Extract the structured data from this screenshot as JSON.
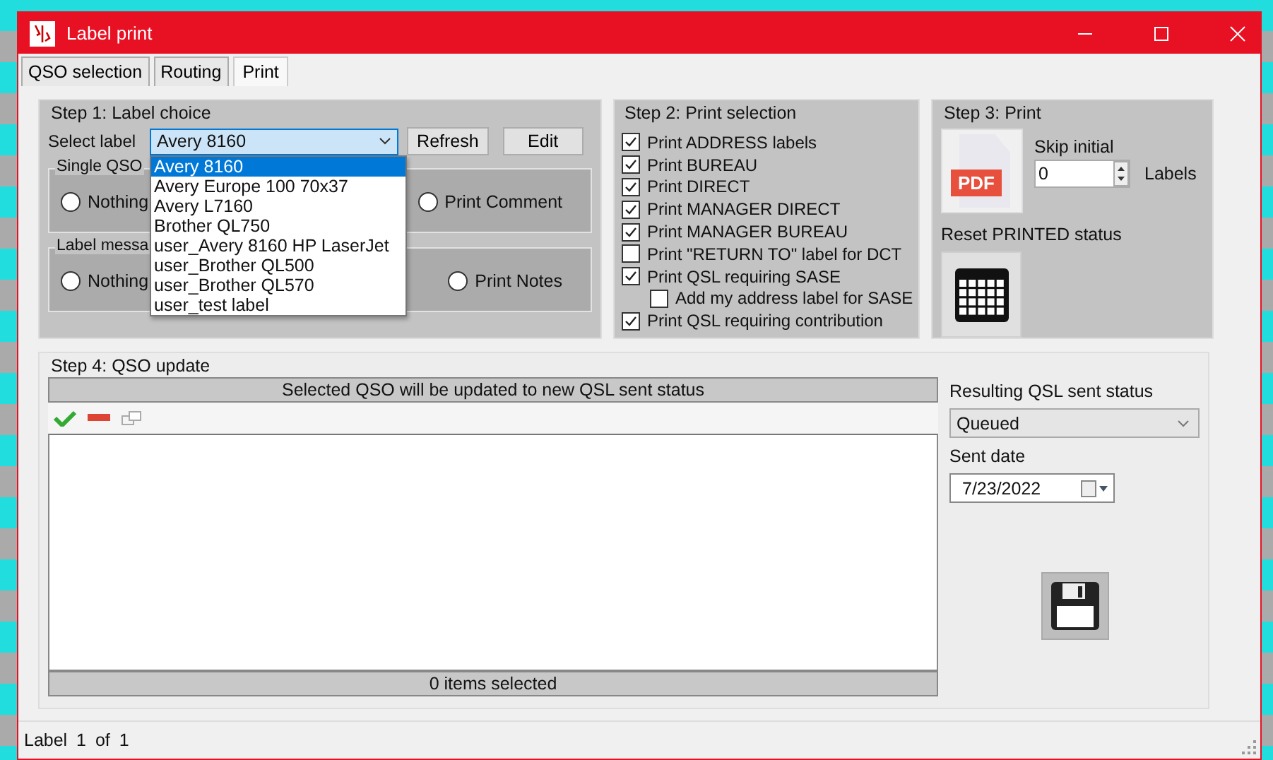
{
  "window": {
    "title": "Label print"
  },
  "tabs": [
    {
      "label": "QSO selection",
      "selected": false
    },
    {
      "label": "Routing",
      "selected": false
    },
    {
      "label": "Print",
      "selected": true
    }
  ],
  "step1": {
    "title": "Step 1: Label choice",
    "select_label": "Select label",
    "selected_value": "Avery 8160",
    "buttons": [
      "Refresh",
      "Edit"
    ],
    "dropdown_options": [
      {
        "label": "Avery 8160",
        "selected": true
      },
      {
        "label": "Avery Europe 100 70x37",
        "selected": false
      },
      {
        "label": "Avery L7160",
        "selected": false
      },
      {
        "label": "Brother QL750",
        "selected": false
      },
      {
        "label": "user_Avery 8160 HP LaserJet",
        "selected": false
      },
      {
        "label": "user_Brother QL500",
        "selected": false
      },
      {
        "label": "user_Brother QL570",
        "selected": false
      },
      {
        "label": "user_test label",
        "selected": false
      }
    ],
    "groups": [
      {
        "title": "Single QSO",
        "options": [
          {
            "label": "Nothing",
            "selected": false
          },
          {
            "label": "Print Comment",
            "selected": false
          }
        ]
      },
      {
        "title": "Label messa",
        "options": [
          {
            "label": "Nothing",
            "selected": false
          },
          {
            "label": "Print Notes",
            "selected": false
          }
        ]
      }
    ]
  },
  "step2": {
    "title": "Step 2: Print selection",
    "options": [
      {
        "label": "Print ADDRESS labels",
        "checked": true
      },
      {
        "label": "Print BUREAU",
        "checked": true
      },
      {
        "label": "Print DIRECT",
        "checked": true
      },
      {
        "label": "Print MANAGER DIRECT",
        "checked": true
      },
      {
        "label": "Print MANAGER BUREAU",
        "checked": true
      },
      {
        "label": "Print \"RETURN TO\" label for DCT",
        "checked": false
      },
      {
        "label": "Print QSL requiring SASE",
        "checked": true,
        "children": [
          {
            "label": "Add my address label for SASE",
            "checked": false
          }
        ]
      },
      {
        "label": "Print QSL requiring contribution",
        "checked": true
      }
    ]
  },
  "step3": {
    "title": "Step 3: Print",
    "pdf_text": "PDF",
    "skip_label": "Skip initial",
    "skip_value": "0",
    "labels_text": "Labels",
    "reset_label": "Reset PRINTED status"
  },
  "step4": {
    "title": "Step 4: QSO update",
    "list_header": "Selected QSO will be updated to new QSL sent status",
    "list_footer": "0 items selected",
    "status_label": "Resulting QSL sent status",
    "status_value": "Queued",
    "date_label": "Sent date",
    "date_value": "7/23/2022"
  },
  "status_bar": {
    "text": "Label 1 of 1"
  }
}
